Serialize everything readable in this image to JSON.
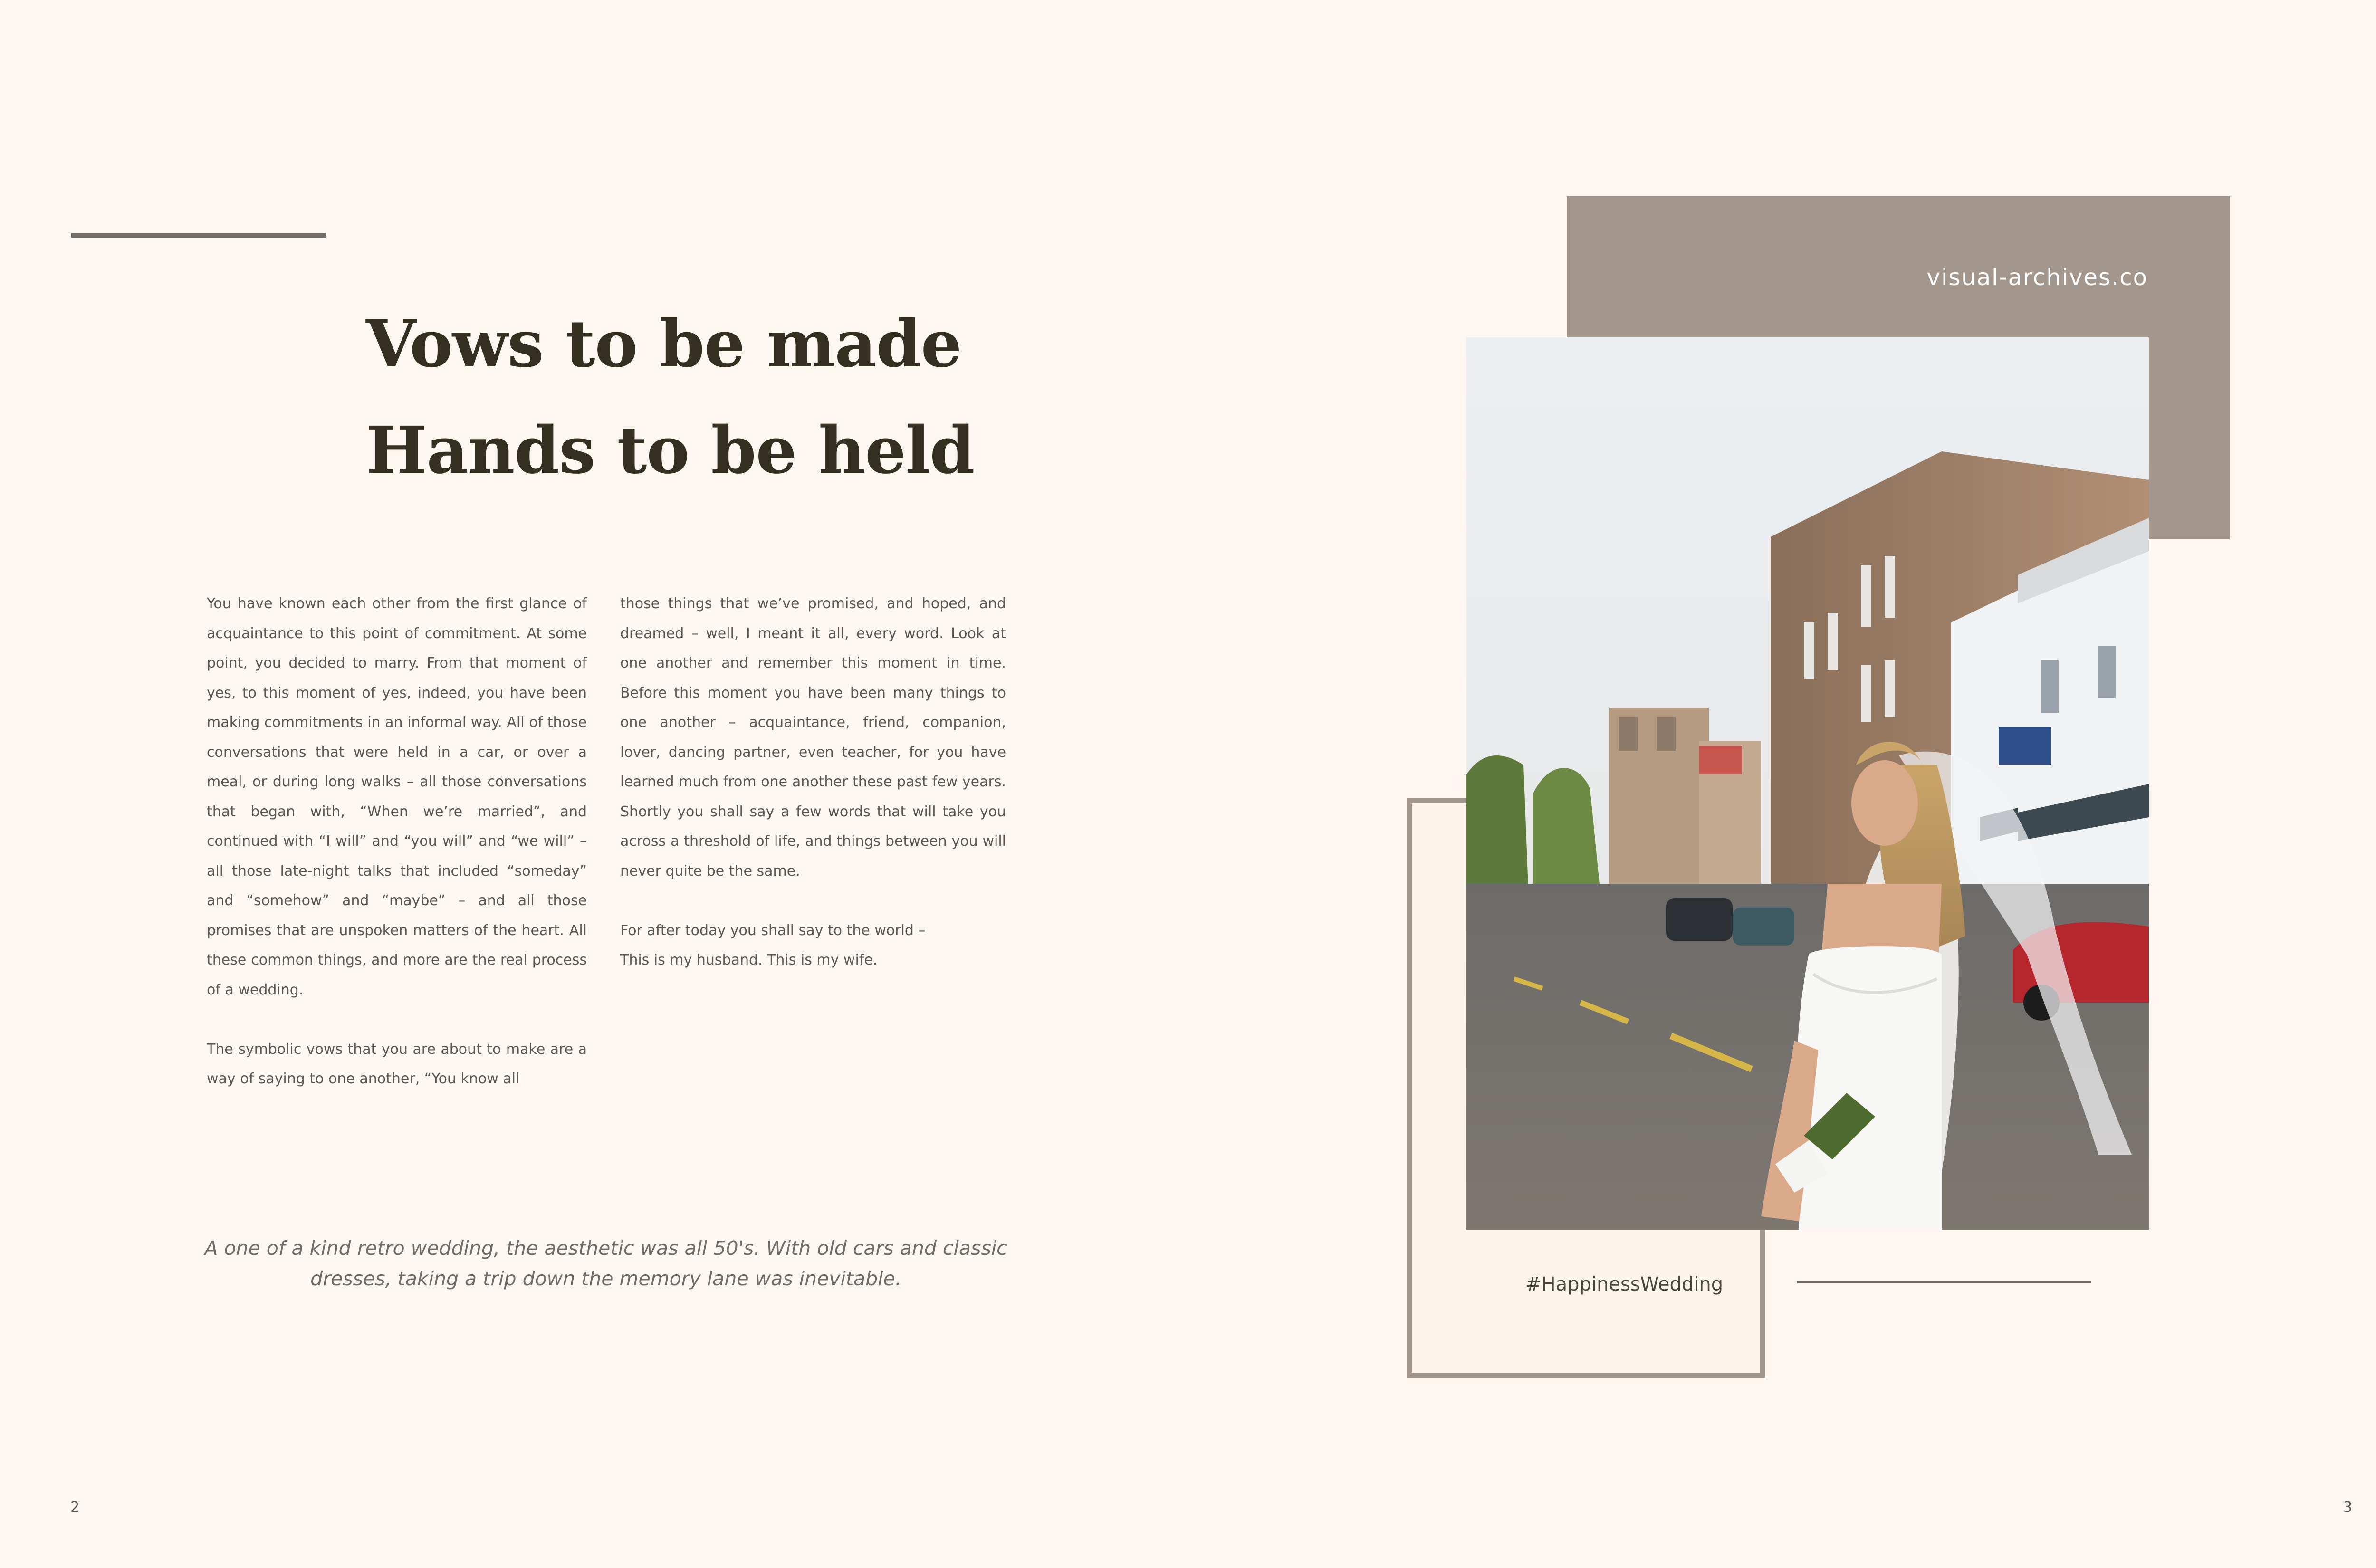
{
  "headline": {
    "line1": "Vows to be made",
    "line2": "Hands to be held"
  },
  "body": {
    "left_paragraphs": [
      "You have known each other from the first glance of acquaintance to this point of commitment. At some point, you decided to marry. From that moment of yes, to this moment of yes, indeed, you have been making commitments in an informal way. All of those conversations that were held in a car, or over a meal, or during long walks – all those conversations that began with, “When we’re married”, and continued with “I will” and “you will” and “we will” – all those late-night talks that included “someday” and “somehow” and “maybe” – and all those promises that are unspoken matters of the heart. All these common things, and more are the real process of a wedding.",
      "The symbolic vows that you are about to make are a way of saying to one another, “You know all"
    ],
    "right_paragraph": "those things that we’ve promised, and hoped, and dreamed – well, I meant it all, every word. Look at one another and remember this moment in time. Before this moment you have been many things to one another – acquaintance, friend, companion, lover, dancing partner, even teacher, for you have learned much from one another these past few years. Shortly you shall say a few words that will take you across a threshold of life, and things between you will never quite be the same.",
    "closing_lines": [
      "For after today you shall say to the world –",
      "This is my husband. This is my wife."
    ]
  },
  "caption": "A one of a kind retro wedding, the aesthetic was all 50's. With old cars and classic dresses, taking a trip down the memory lane was inevitable.",
  "site_url": "visual-archives.co",
  "hashtag": "#HappinessWedding",
  "page_numbers": {
    "left": "2",
    "right": "3"
  },
  "colors": {
    "background": "#fdf6f1",
    "headline": "#333021",
    "taupe": "#a3978d",
    "rule": "#716b66",
    "body_text": "#5d5650"
  },
  "photo": {
    "icon": "bride-street-photo"
  }
}
